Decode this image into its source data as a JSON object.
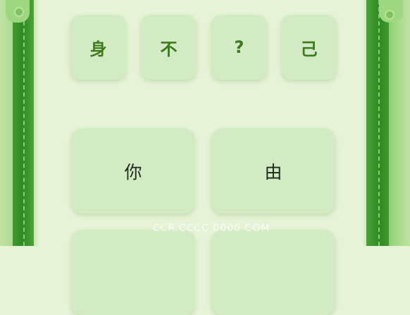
{
  "puzzle": {
    "answer_slots": [
      {
        "char": "身"
      },
      {
        "char": "不"
      },
      {
        "char": "?"
      },
      {
        "char": "己"
      }
    ]
  },
  "options": [
    {
      "char": "你"
    },
    {
      "char": "由"
    },
    {
      "char": ""
    },
    {
      "char": ""
    }
  ],
  "watermark": "CCR.CCCC  0000  COM",
  "colors": {
    "background": "#e6f3d6",
    "tile": "#d3ebc4",
    "slot_text": "#3c7a1c",
    "option_text": "#1f2a1a",
    "frame_dark": "#2f8a24",
    "frame_light": "#a6d98a"
  }
}
